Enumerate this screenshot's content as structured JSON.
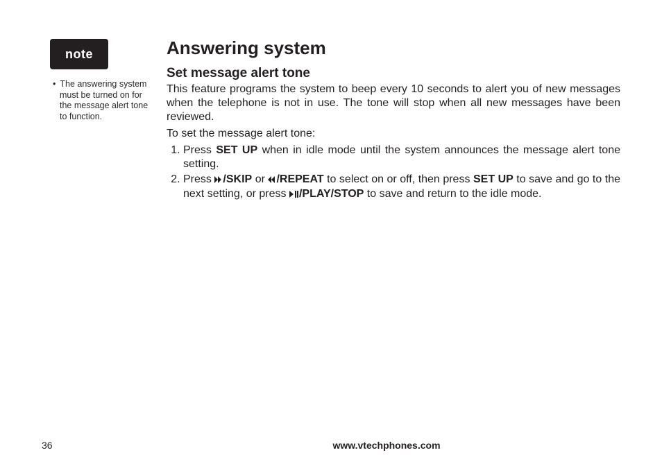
{
  "sidebar": {
    "note_label": "note",
    "bullets": [
      "The answering system must be turned on for the message alert tone to function."
    ]
  },
  "main": {
    "h1": "Answering system",
    "h2": "Set message alert tone",
    "intro": "This feature programs the system to beep every 10 seconds to alert you of new messages when the telephone is not in use. The tone will stop when all new messages have been reviewed.",
    "lead": "To set the message alert tone:",
    "steps": {
      "s1_a": "Press ",
      "s1_b": "SET UP",
      "s1_c": " when in idle mode until the system announces the message alert tone setting.",
      "s2_a": "Press ",
      "s2_skip": "/SKIP",
      "s2_b": " or ",
      "s2_repeat": "/REPEAT",
      "s2_c": " to select on or off, then press ",
      "s2_setup": "SET UP",
      "s2_d": " to save and go to the next setting, or press ",
      "s2_play": "/PLAY/STOP",
      "s2_e": " to save and return to the idle mode."
    }
  },
  "footer": {
    "page_number": "36",
    "url": "www.vtechphones.com"
  }
}
